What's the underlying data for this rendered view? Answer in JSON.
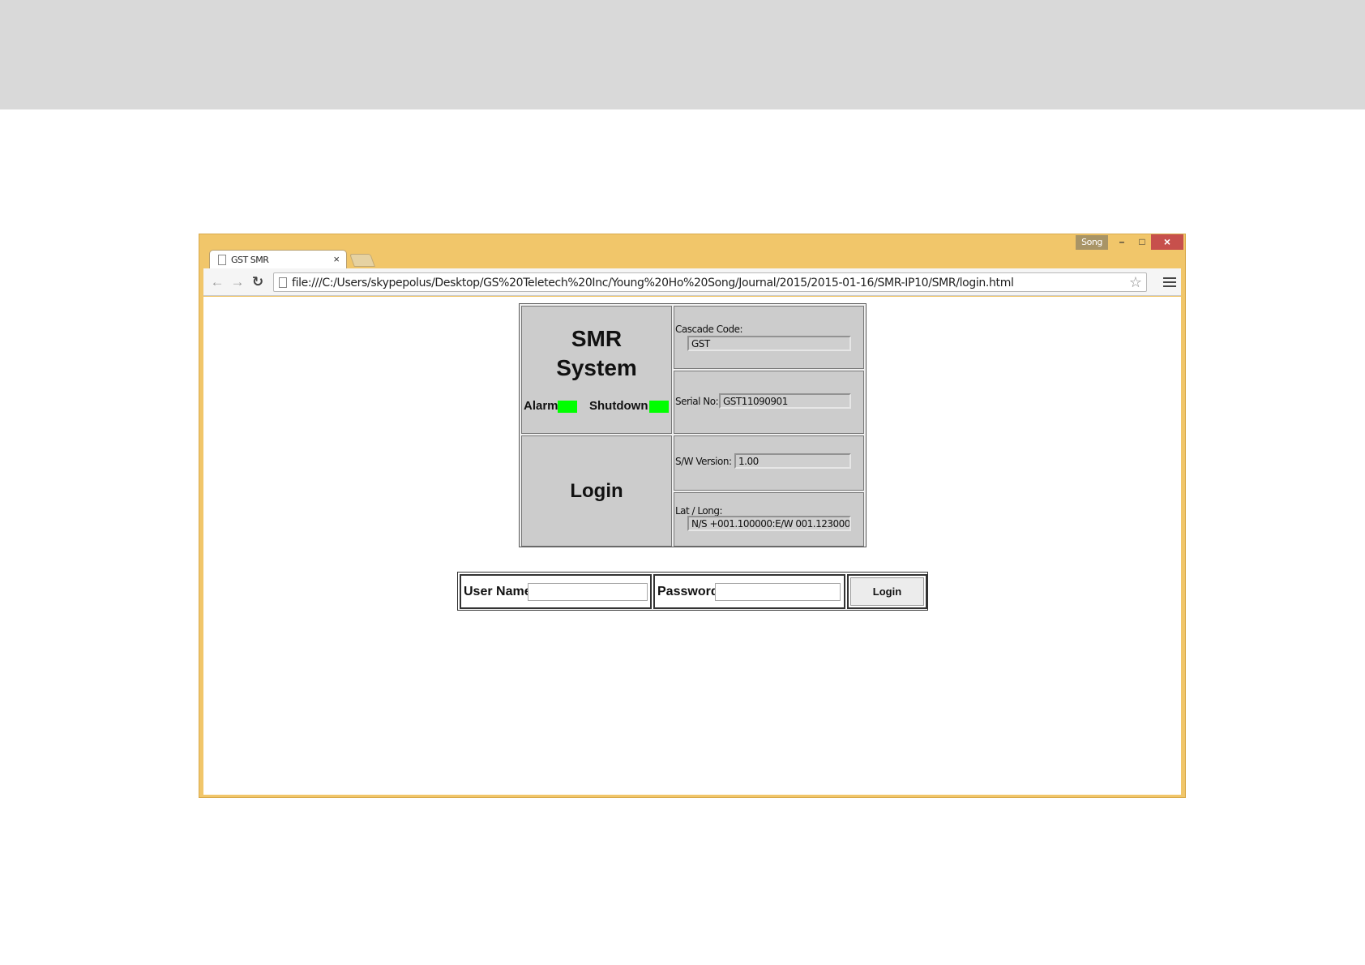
{
  "window": {
    "user_badge": "Song",
    "minimize_glyph": "–",
    "maximize_glyph": "□",
    "close_glyph": "×"
  },
  "tab": {
    "title": "GST SMR",
    "close_glyph": "×"
  },
  "toolbar": {
    "back_glyph": "←",
    "forward_glyph": "→",
    "reload_glyph": "↻",
    "url": "file:///C:/Users/skypepolus/Desktop/GS%20Teletech%20Inc/Young%20Ho%20Song/Journal/2015/2015-01-16/SMR-IP10/SMR/login.html",
    "star_glyph": "☆"
  },
  "info_panel": {
    "system_title_line1": "SMR",
    "system_title_line2": "System",
    "alarm_label": "Alarm",
    "shutdown_label": "Shutdown",
    "indicator_color": "#00ff00",
    "login_heading": "Login",
    "cascade_code_label": "Cascade Code:",
    "cascade_code_value": "GST",
    "serial_no_label": "Serial No:",
    "serial_no_value": "GST11090901",
    "sw_version_label": "S/W Version:",
    "sw_version_value": "1.00",
    "lat_long_label": "Lat / Long:",
    "lat_long_value": "N/S +001.100000:E/W 001.123000"
  },
  "login_form": {
    "username_label": "User Name",
    "username_value": "",
    "password_label": "Password",
    "password_value": "",
    "submit_label": "Login"
  },
  "colors": {
    "window_frame": "#f1c66a",
    "close_button": "#c7504c",
    "panel_gray": "#cccccc"
  }
}
